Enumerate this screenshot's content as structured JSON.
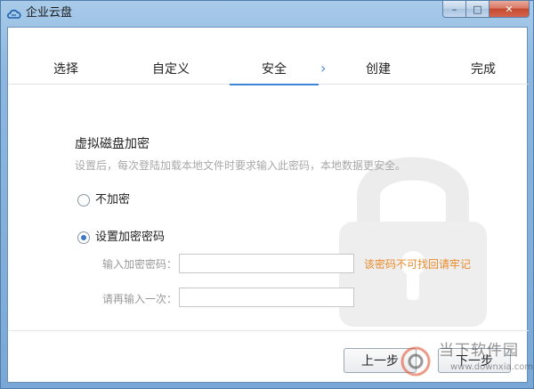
{
  "window": {
    "title": "企业云盘",
    "icon": "cloud-icon"
  },
  "caption": {
    "minimize": "–",
    "maximize": "□",
    "close": "✕"
  },
  "steps": [
    {
      "label": "选择"
    },
    {
      "label": "自定义"
    },
    {
      "label": "安全",
      "active": true
    },
    {
      "label": "创建"
    },
    {
      "label": "完成"
    }
  ],
  "step_arrow": "›",
  "section": {
    "title": "虚拟磁盘加密",
    "description": "设置后，每次登陆加载本地文件时要求输入此密码，本地数据更安全。"
  },
  "options": [
    {
      "label": "不加密",
      "checked": false
    },
    {
      "label": "设置加密密码",
      "checked": true
    }
  ],
  "fields": {
    "password_label": "输入加密密码：",
    "password_value": "",
    "confirm_label": "请再输入一次：",
    "confirm_value": ""
  },
  "hint": "该密码不可找回请牢记",
  "buttons": {
    "prev": "上一步",
    "next": "下一步"
  },
  "watermark": {
    "brand": "当下软件园",
    "url": "www.downxia.com"
  },
  "colors": {
    "accent": "#3b84d6",
    "hint": "#e98a2a",
    "titlebar": "#8db7df"
  }
}
